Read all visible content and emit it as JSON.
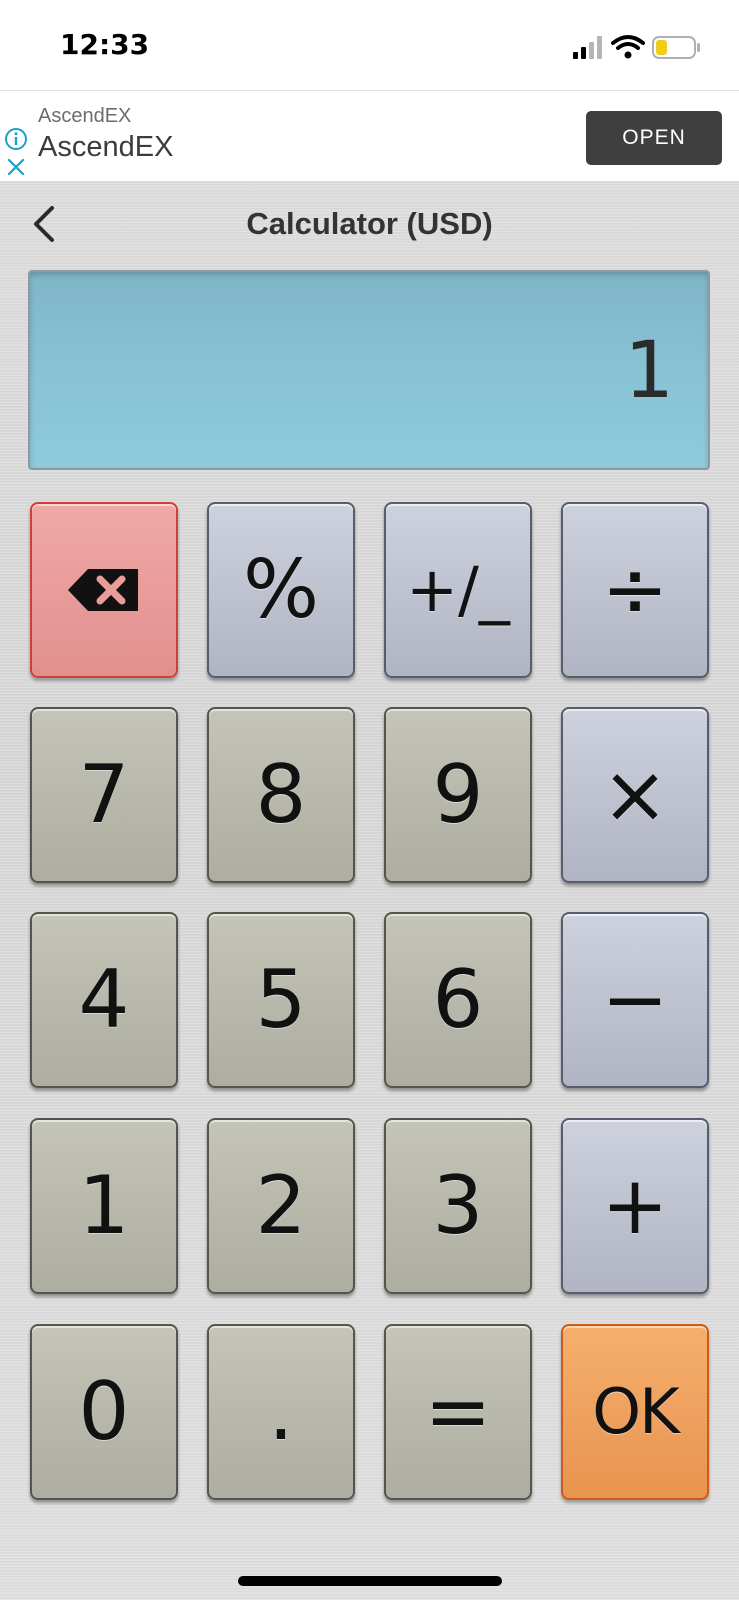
{
  "status_bar": {
    "time": "12:33",
    "icons": [
      "cellular-signal-icon",
      "wifi-icon",
      "battery-low-icon"
    ]
  },
  "ad": {
    "advertiser": "AscendEX",
    "title": "AscendEX",
    "button_label": "OPEN",
    "icons": [
      "info-icon",
      "close-icon"
    ]
  },
  "nav": {
    "title": "Calculator (USD)",
    "back_icon": "chevron-left-icon"
  },
  "display": {
    "value": "1"
  },
  "keys": {
    "row1": [
      "backspace",
      "%",
      "+/_",
      "÷"
    ],
    "row2": [
      "7",
      "8",
      "9",
      "×"
    ],
    "row3": [
      "4",
      "5",
      "6",
      "−"
    ],
    "row4": [
      "1",
      "2",
      "3",
      "+"
    ],
    "row5": [
      "0",
      ".",
      "=",
      "OK"
    ]
  },
  "colors": {
    "display_bg": "#88c2d3",
    "digit_key": "#b8b8ac",
    "operator_key": "#bfc3d0",
    "backspace_key": "#e99c9a",
    "ok_key": "#efa160",
    "ad_button": "#3f3f3f",
    "ad_info_accent": "#1aa0c9"
  }
}
